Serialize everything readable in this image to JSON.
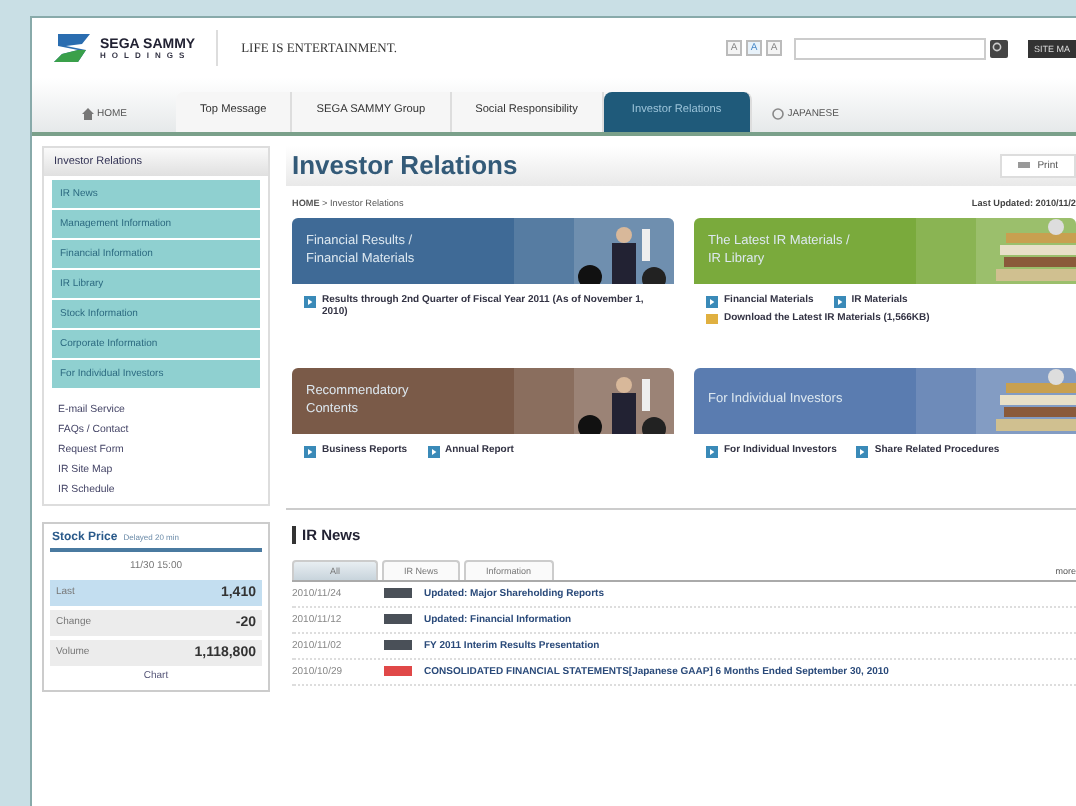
{
  "header": {
    "logo_name": "SEGA SAMMY",
    "logo_sub": "HOLDINGS",
    "tagline": "LIFE IS ENTERTAINMENT.",
    "font_sizes": [
      {
        "label": "A",
        "selected": false
      },
      {
        "label": "A",
        "selected": true
      },
      {
        "label": "A",
        "selected": false
      }
    ],
    "site_map": "SITE MA"
  },
  "nav": {
    "home": "HOME",
    "tabs": [
      {
        "label": "Top Message",
        "selected": false
      },
      {
        "label": "SEGA SAMMY Group",
        "selected": false
      },
      {
        "label": "Social Responsibility",
        "selected": false
      },
      {
        "label": "Investor Relations",
        "selected": true
      }
    ],
    "language": "JAPANESE"
  },
  "sidebar": {
    "title": "Investor Relations",
    "items": [
      {
        "label": "IR News",
        "kind": "main"
      },
      {
        "label": "Management Information",
        "kind": "main"
      },
      {
        "label": "Financial Information",
        "kind": "main"
      },
      {
        "label": "IR Library",
        "kind": "main"
      },
      {
        "label": "Stock Information",
        "kind": "main"
      },
      {
        "label": "Corporate Information",
        "kind": "main"
      },
      {
        "label": "For Individual Investors",
        "kind": "main"
      },
      {
        "label": "E-mail Service",
        "kind": "sub"
      },
      {
        "label": "FAQs / Contact",
        "kind": "sub"
      },
      {
        "label": "Request Form",
        "kind": "sub"
      },
      {
        "label": "IR Site Map",
        "kind": "sub"
      },
      {
        "label": "IR Schedule",
        "kind": "sub"
      }
    ],
    "stock": {
      "title": "Stock Price",
      "note": "Delayed 20 min",
      "time": "11/30 15:00",
      "rows": [
        {
          "label": "Last",
          "value": "1,410",
          "selected": true
        },
        {
          "label": "Change",
          "value": "-20",
          "selected": false
        },
        {
          "label": "Volume",
          "value": "1,118,800",
          "selected": false
        }
      ],
      "chart_link": "Chart"
    }
  },
  "main": {
    "title": "Investor Relations",
    "print": "Print",
    "breadcrumb": "**HOME** > Investor Relations",
    "updated": "Last Updated: 2010/11/2",
    "cards": [
      {
        "title": "Financial Results / Financial Materials",
        "color": "#3f6a96",
        "links": [
          {
            "label": "Results through 2nd Quarter of Fiscal Year 2011 (As of November 1, 2010)",
            "kind": "page"
          }
        ]
      },
      {
        "title": "The Latest IR Materials / IR Library",
        "color": "#7aaa3c",
        "links": [
          {
            "label": "Financial Materials",
            "kind": "page"
          },
          {
            "label": "IR Materials",
            "kind": "page"
          },
          {
            "label": "Download the Latest IR Materials (1,566KB)",
            "kind": "download"
          }
        ]
      },
      {
        "title": "Recommendatory Contents",
        "color": "#7a5a48",
        "links": [
          {
            "label": "Business Reports",
            "kind": "page"
          },
          {
            "label": "Annual Report",
            "kind": "page"
          }
        ]
      },
      {
        "title": "For Individual Investors",
        "color": "#5a7cb0",
        "links": [
          {
            "label": "For Individual Investors",
            "kind": "page"
          },
          {
            "label": "Share Related Procedures",
            "kind": "page"
          }
        ]
      }
    ],
    "news": {
      "title": "IR News",
      "tabs": [
        {
          "label": "All",
          "selected": true
        },
        {
          "label": "IR News",
          "selected": false
        },
        {
          "label": "Information",
          "selected": false
        }
      ],
      "more": "more",
      "rows": [
        {
          "date": "2010/11/24",
          "color": "#4a5058",
          "text": "Updated: Major Shareholding Reports"
        },
        {
          "date": "2010/11/12",
          "color": "#4a5058",
          "text": "Updated: Financial Information"
        },
        {
          "date": "2010/11/02",
          "color": "#4a5058",
          "text": "FY 2011 Interim Results Presentation"
        },
        {
          "date": "2010/10/29",
          "color": "#e04848",
          "text": "CONSOLIDATED FINANCIAL STATEMENTS[Japanese GAAP] 6 Months Ended September 30, 2010"
        }
      ]
    }
  }
}
